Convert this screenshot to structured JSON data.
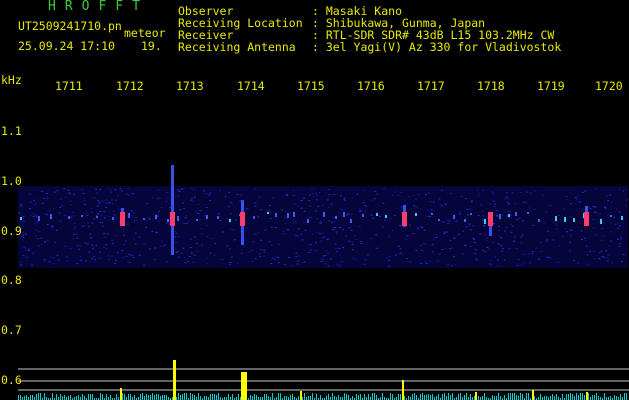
{
  "header": {
    "title": "HROFFT",
    "filename": "UT2509241710.pn",
    "meteor_label": "meteor",
    "datetime": "25.09.24 17:10",
    "count": "19.",
    "fields": [
      {
        "label": "Observer",
        "value": ": Masaki Kano"
      },
      {
        "label": "Receiving Location",
        "value": ": Shibukawa, Gunma, Japan"
      },
      {
        "label": "Receiver",
        "value": ": RTL-SDR SDR# 43dB L15 103.2MHz CW"
      },
      {
        "label": "Receiving Antenna",
        "value": ": 3el Yagi(V) Az 330 for Vladivostok"
      }
    ]
  },
  "axes": {
    "y_unit": "kHz",
    "x_ticks": [
      "1711",
      "1712",
      "1713",
      "1714",
      "1715",
      "1716",
      "1717",
      "1718",
      "1719",
      "1720"
    ],
    "y_ticks": [
      "1.1",
      "1.0",
      "0.9",
      "0.8",
      "0.7",
      "0.6"
    ]
  },
  "colors": {
    "background": "#000000",
    "spectrogram_band": "#0a0a6e",
    "text": "#e8e800",
    "title": "#3ec83e",
    "meteor_echo": "#ff3c6e",
    "strength_bars": "#ffff00",
    "noise_floor": "#00d0d0"
  }
}
